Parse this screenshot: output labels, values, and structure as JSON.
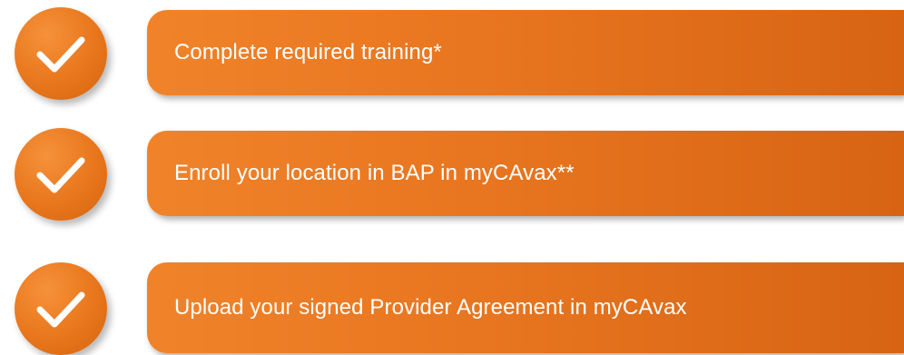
{
  "steps": [
    {
      "label": "Complete required training*",
      "icon": "checkmark-icon"
    },
    {
      "label": "Enroll your location in BAP in myCAvax**",
      "icon": "checkmark-icon"
    },
    {
      "label": "Upload your signed Provider Agreement in myCAvax",
      "icon": "checkmark-icon"
    }
  ],
  "colors": {
    "accent": "#e8761c",
    "text": "#ffffff"
  }
}
